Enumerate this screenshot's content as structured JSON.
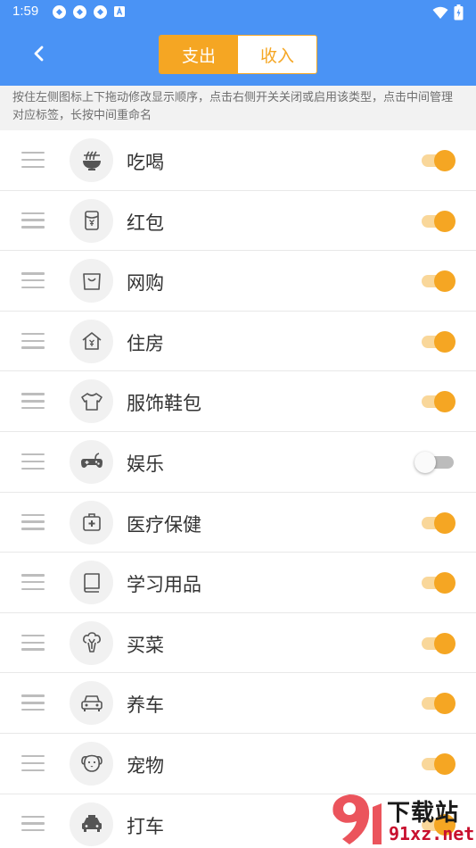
{
  "status_bar": {
    "time": "1:59"
  },
  "header": {
    "tabs": [
      {
        "label": "支出",
        "active": true
      },
      {
        "label": "收入",
        "active": false
      }
    ]
  },
  "hint": "按住左侧图标上下拖动修改显示顺序，点击右侧开关关闭或启用该类型，点击中间管理对应标签，长按中间重命名",
  "categories": [
    {
      "name": "吃喝",
      "icon": "noodle-bowl-icon",
      "enabled": true
    },
    {
      "name": "红包",
      "icon": "red-envelope-icon",
      "enabled": true
    },
    {
      "name": "网购",
      "icon": "shopping-bag-icon",
      "enabled": true
    },
    {
      "name": "住房",
      "icon": "house-icon",
      "enabled": true
    },
    {
      "name": "服饰鞋包",
      "icon": "tshirt-icon",
      "enabled": true
    },
    {
      "name": "娱乐",
      "icon": "gamepad-icon",
      "enabled": false
    },
    {
      "name": "医疗保健",
      "icon": "medical-kit-icon",
      "enabled": true
    },
    {
      "name": "学习用品",
      "icon": "book-icon",
      "enabled": true
    },
    {
      "name": "买菜",
      "icon": "broccoli-icon",
      "enabled": true
    },
    {
      "name": "养车",
      "icon": "car-icon",
      "enabled": true
    },
    {
      "name": "宠物",
      "icon": "dog-icon",
      "enabled": true
    },
    {
      "name": "打车",
      "icon": "taxi-icon",
      "enabled": true
    }
  ],
  "watermark": {
    "text": "下载站",
    "url": "91xz.net"
  },
  "colors": {
    "primary": "#4a93f5",
    "accent": "#f5a623",
    "hint_bg": "#f2f2f2"
  }
}
